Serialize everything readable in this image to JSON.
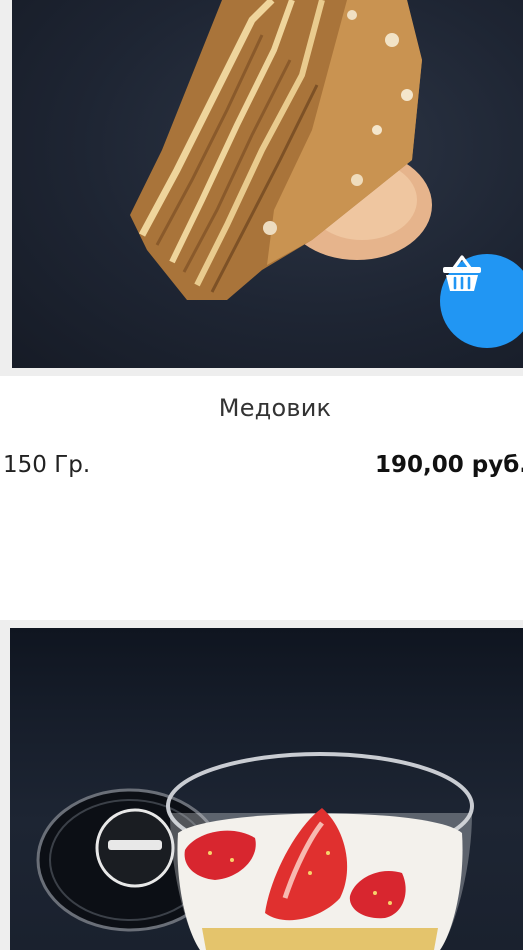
{
  "products": [
    {
      "name": "Медовик",
      "weight": "150 Гр.",
      "price": "190,00 руб."
    }
  ],
  "icons": {
    "cart": "basket-icon"
  },
  "colors": {
    "accent": "#2196f3",
    "card_border": "#eeeeee",
    "photo_background": "#1e2533"
  }
}
